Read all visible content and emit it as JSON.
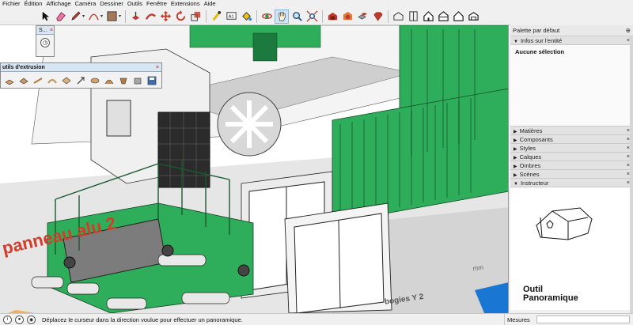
{
  "menu": [
    "Fichier",
    "Édition",
    "Affichage",
    "Caméra",
    "Dessiner",
    "Outils",
    "Fenêtre",
    "Extensions",
    "Aide"
  ],
  "toolbar": {
    "tools": [
      "select-icon",
      "eraser-icon",
      "pencil-icon",
      "arc-icon",
      "rectangle-icon",
      "push-pull-icon",
      "follow-me-icon",
      "move-icon",
      "rotate-icon",
      "scale-icon",
      "tape-measure-icon",
      "text-icon",
      "paint-bucket-icon",
      "orbit-icon",
      "pan-icon",
      "zoom-icon",
      "zoom-extents-icon",
      "warehouse-icon",
      "extension-warehouse-icon",
      "components-icon",
      "ruby-icon",
      "iso-view-icon",
      "top-view-icon",
      "front-view-icon",
      "right-view-icon",
      "back-view-icon",
      "left-view-icon"
    ],
    "selected": "pan-icon"
  },
  "small_panel": {
    "title": "S...",
    "close": "×"
  },
  "extrusion_panel": {
    "title": "utils d'extrusion",
    "close": "×"
  },
  "tray": {
    "title": "Palette par défaut",
    "pin": "⊕",
    "entity_info": {
      "label": "Infos sur l'entité",
      "value": "Aucune sélection"
    },
    "sections": [
      "Matières",
      "Composants",
      "Styles",
      "Calques",
      "Ombres",
      "Scènes"
    ],
    "instructor": {
      "label": "Instructeur",
      "tool_title_1": "Outil",
      "tool_title_2": "Panoramique"
    }
  },
  "scene_text": {
    "signage": "panneau alu 2",
    "label1": "bogies Y 2",
    "label2": "mm"
  },
  "status": {
    "message": "Déplacez le curseur dans la direction voulue pour effectuer un panoramique.",
    "measures_label": "Mesures"
  },
  "colors": {
    "model_green": "#2eae5a",
    "selection_blue": "#cfe3f7",
    "floor_grey": "#d7d7d7",
    "text_red": "#d23c2a"
  }
}
